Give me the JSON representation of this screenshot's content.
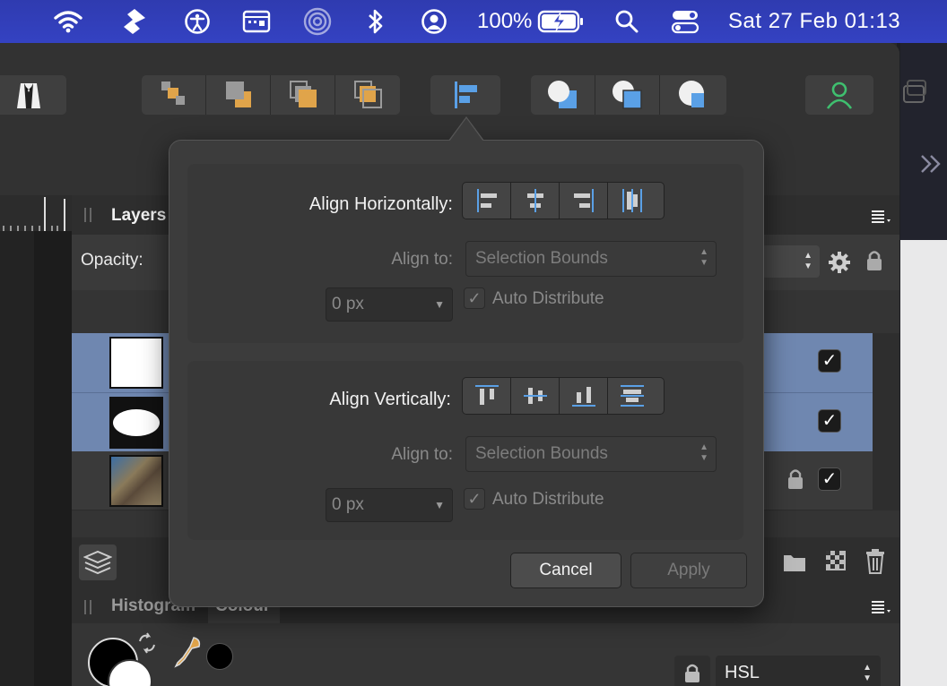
{
  "menubar": {
    "battery_percent": "100%",
    "datetime": "Sat 27 Feb  01:13",
    "icons": [
      "wifi-icon",
      "script-icon",
      "accessibility-icon",
      "keyboard-viewer-icon",
      "airdrop-icon",
      "bluetooth-icon",
      "user-icon",
      "battery-charging-icon",
      "search-icon",
      "control-center-icon"
    ]
  },
  "toolbar": {
    "groups": [
      {
        "name": "arrange",
        "icons": [
          "move-back-one-icon",
          "move-forward-one-icon",
          "move-to-back-icon",
          "move-to-front-icon"
        ]
      },
      {
        "name": "alignment",
        "icons": [
          "align-icon"
        ]
      },
      {
        "name": "boolean",
        "icons": [
          "add-shapes-icon",
          "subtract-shapes-icon",
          "intersect-shapes-icon"
        ]
      },
      {
        "name": "personas",
        "icons": [
          "user-persona-icon"
        ]
      }
    ],
    "accent_orange": "#e0a44a",
    "accent_blue": "#5aa0e6",
    "accent_green": "#3fbf6f"
  },
  "layers_panel": {
    "tab_label": "Layers",
    "opacity_label": "Opacity:",
    "rows": [
      {
        "thumb": "white-rectangle",
        "selected": true,
        "visible": true,
        "locked": false
      },
      {
        "thumb": "white-ellipse",
        "selected": true,
        "visible": true,
        "locked": false
      },
      {
        "thumb": "photo",
        "selected": false,
        "visible": true,
        "locked": true
      }
    ]
  },
  "colour_panel": {
    "tabs": [
      "Histogram",
      "Colour"
    ],
    "active_tab": "Colour",
    "model_select": "HSL"
  },
  "popover": {
    "horizontal": {
      "label": "Align Horizontally:",
      "align_to_label": "Align to:",
      "align_to_value": "Selection Bounds",
      "spacing_value": "0 px",
      "auto_distribute_label": "Auto Distribute",
      "auto_distribute_checked": true,
      "buttons": [
        "align-left-icon",
        "align-center-icon",
        "align-right-icon",
        "space-evenly-horizontal-icon"
      ]
    },
    "vertical": {
      "label": "Align Vertically:",
      "align_to_label": "Align to:",
      "align_to_value": "Selection Bounds",
      "spacing_value": "0 px",
      "auto_distribute_label": "Auto Distribute",
      "auto_distribute_checked": true,
      "buttons": [
        "align-top-icon",
        "align-middle-icon",
        "align-bottom-icon",
        "space-evenly-vertical-icon"
      ]
    },
    "cancel_label": "Cancel",
    "apply_label": "Apply"
  }
}
